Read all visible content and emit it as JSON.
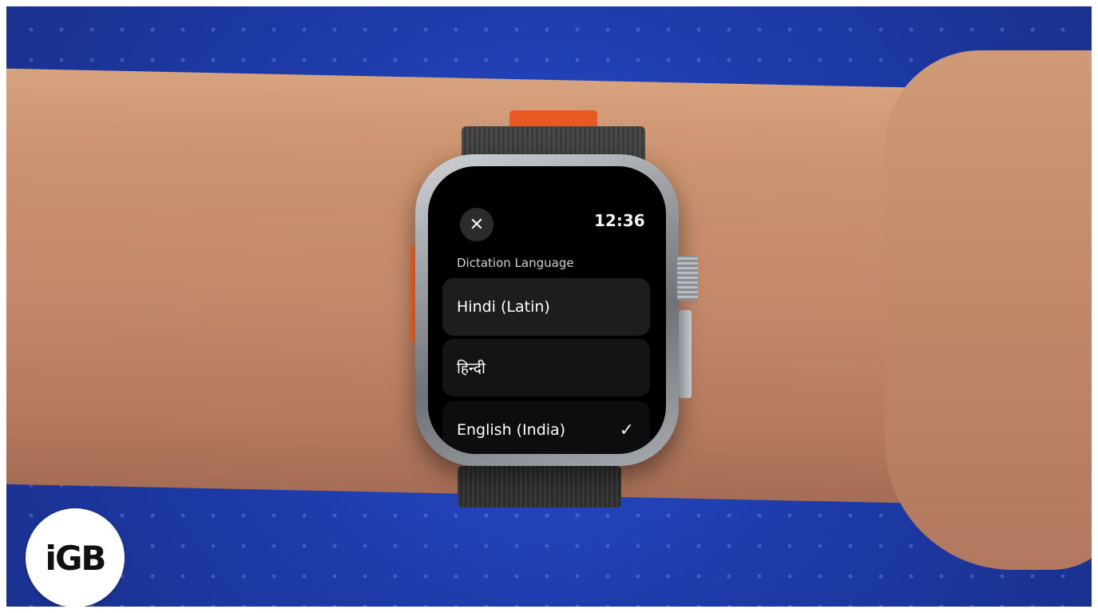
{
  "watch": {
    "time": "12:36",
    "close_icon": "close-icon",
    "title": "Dictation Language",
    "options": [
      {
        "label": "Hindi (Latin)",
        "selected": false
      },
      {
        "label": "हिन्दी",
        "selected": false
      },
      {
        "label": "English (India)",
        "selected": true
      }
    ],
    "check_icon": "checkmark-icon"
  },
  "logo": {
    "text": "iGB"
  },
  "colors": {
    "background": "#1f3db0",
    "band_accent": "#e85a22",
    "screen": "#000000"
  }
}
